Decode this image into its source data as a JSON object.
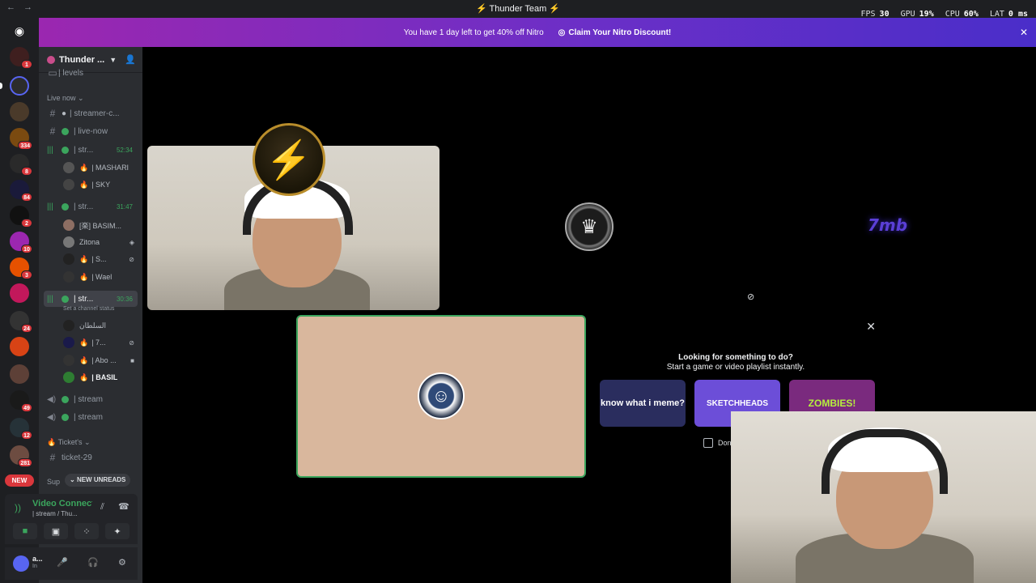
{
  "titlebar": {
    "title": "Thunder Team",
    "back": "←",
    "forward": "→"
  },
  "stats": {
    "fps_label": "FPS",
    "fps": "30",
    "gpu_label": "GPU",
    "gpu": "19%",
    "cpu_label": "CPU",
    "cpu": "60%",
    "lat_label": "LAT",
    "lat": "0 ms"
  },
  "banner": {
    "message": "You have 1 day left to get 40% off Nitro",
    "claim": "Claim Your Nitro Discount!"
  },
  "server": {
    "name": "Thunder ..."
  },
  "server_rail": {
    "badges": [
      "1",
      "334",
      "8",
      "84",
      "2",
      "10",
      "3",
      "24",
      "49",
      "12",
      "281"
    ],
    "new_label": "NEW"
  },
  "channels": {
    "levels": "| levels",
    "live_now_category": "Live now",
    "streamer_chat": "| streamer-c...",
    "live_now": "| live-now",
    "stream1": {
      "name": "| str...",
      "time": "52:34"
    },
    "stream1_users": [
      "| MASHARI",
      "| SKY"
    ],
    "stream2": {
      "name": "| str...",
      "time": "31:47"
    },
    "stream2_users": [
      "[楽] BASIM...",
      "Zitona",
      "| S...",
      "| Wael"
    ],
    "stream3": {
      "name": "| str...",
      "time": "30:36",
      "status": "Set a channel status"
    },
    "stream3_users": [
      "السلطان",
      "| 7...",
      "| Abo ...",
      "| BASIL"
    ],
    "stream4": "| stream",
    "stream5": "| stream",
    "tickets_category": "Ticket's",
    "ticket29": "ticket-29",
    "support_partial": "Sup",
    "new_unreads": "NEW UNREADS"
  },
  "voice": {
    "connected": "Video Connected",
    "channel": "| stream / Thu..."
  },
  "user": {
    "name": "a...",
    "status": "In"
  },
  "activity": {
    "heading": "Looking for something to do?",
    "subheading": "Start a game or video playlist instantly.",
    "games": [
      "know what i meme?",
      "SKETCHHEADS",
      "ZOMBIES!"
    ],
    "dont_show": "Don"
  },
  "tiles": {
    "logo_text": "7mb"
  }
}
